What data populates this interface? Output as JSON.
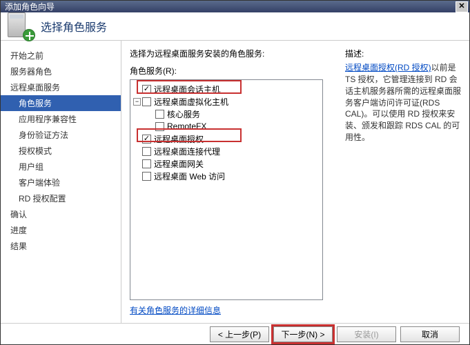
{
  "title": "添加角色向导",
  "header": {
    "title": "选择角色服务"
  },
  "sidebar": {
    "items": [
      {
        "label": "开始之前",
        "indent": false
      },
      {
        "label": "服务器角色",
        "indent": false
      },
      {
        "label": "远程桌面服务",
        "indent": false
      },
      {
        "label": "角色服务",
        "indent": true,
        "selected": true
      },
      {
        "label": "应用程序兼容性",
        "indent": true
      },
      {
        "label": "身份验证方法",
        "indent": true
      },
      {
        "label": "授权模式",
        "indent": true
      },
      {
        "label": "用户组",
        "indent": true
      },
      {
        "label": "客户端体验",
        "indent": true
      },
      {
        "label": "RD 授权配置",
        "indent": true
      },
      {
        "label": "确认",
        "indent": false
      },
      {
        "label": "进度",
        "indent": false
      },
      {
        "label": "结果",
        "indent": false
      }
    ]
  },
  "main": {
    "instruction": "选择为远程桌面服务安装的角色服务:",
    "tree_label": "角色服务(R):",
    "tree": [
      {
        "label": "远程桌面会话主机",
        "checked": true,
        "highlighted": true
      },
      {
        "label": "远程桌面虚拟化主机",
        "expandable": true
      },
      {
        "label": "核心服务",
        "child": true
      },
      {
        "label": "RemoteFX",
        "child": true
      },
      {
        "label": "远程桌面授权",
        "checked": true,
        "highlighted": true
      },
      {
        "label": "远程桌面连接代理"
      },
      {
        "label": "远程桌面网关"
      },
      {
        "label": "远程桌面 Web 访问"
      }
    ],
    "more_link": "有关角色服务的详细信息"
  },
  "desc": {
    "title": "描述:",
    "link_text": "远程桌面授权(RD 授权)",
    "body": "以前是 TS 授权，它管理连接到 RD 会话主机服务器所需的远程桌面服务客户端访问许可证(RDS CAL)。可以使用 RD 授权来安装、颁发和跟踪 RDS CAL 的可用性。"
  },
  "footer": {
    "prev": "< 上一步(P)",
    "next": "下一步(N) >",
    "install": "安装(I)",
    "cancel": "取消"
  }
}
